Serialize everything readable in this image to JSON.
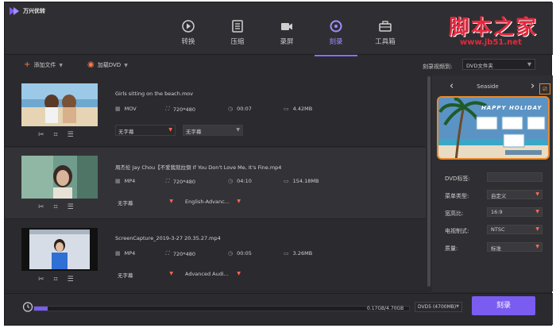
{
  "app": {
    "title": "万兴优转"
  },
  "nav": [
    {
      "label": "转换",
      "icon": "convert-icon"
    },
    {
      "label": "压缩",
      "icon": "compress-icon"
    },
    {
      "label": "录屏",
      "icon": "record-icon"
    },
    {
      "label": "刻录",
      "icon": "burn-icon",
      "active": true
    },
    {
      "label": "工具箱",
      "icon": "toolbox-icon"
    }
  ],
  "toolbar": {
    "add_file": "添加文件",
    "load_dvd": "加载DVD",
    "folder_label": "刻录视频到:",
    "folder_value": "DVD文件夹"
  },
  "files": [
    {
      "name": "Girls sitting on the beach.mov",
      "format": "MOV",
      "resolution": "720*480",
      "duration": "00:07",
      "size": "4.42MB",
      "subtitle": "无字幕",
      "audio": "无字幕"
    },
    {
      "name": "周杰伦 Jay Chou【不爱我就拉倒 If You Don't Love Me, It's Fine.mp4",
      "format": "MP4",
      "resolution": "720*480",
      "duration": "04:10",
      "size": "154.18MB",
      "subtitle": "无字幕",
      "audio": "English-Advanc..."
    },
    {
      "name": "ScreenCapture_2019-3-27 20.35.27.mp4",
      "format": "MP4",
      "resolution": "720*480",
      "duration": "00:05",
      "size": "3.26MB",
      "subtitle": "无字幕",
      "audio": "Advanced Audi..."
    }
  ],
  "template": {
    "name": "Seaside",
    "preview_title": "HAPPY HOLIDAY"
  },
  "props": [
    {
      "label": "DVD标签:",
      "value": ""
    },
    {
      "label": "菜单类型:",
      "value": "自定义"
    },
    {
      "label": "宽高比:",
      "value": "16:9"
    },
    {
      "label": "电视制式:",
      "value": "NTSC"
    },
    {
      "label": "质量:",
      "value": "标准"
    }
  ],
  "footer": {
    "size_text": "0.17GB/4.70GB",
    "disc": "DVD5 (4700MB)",
    "burn_label": "刻录",
    "progress_fraction": 0.036
  },
  "watermark": {
    "main": "脚本之家",
    "url": "www.jb51.net"
  },
  "colors": {
    "accent": "#7b5cf0",
    "highlight": "#e8892e",
    "watermark": "#e8273d"
  }
}
